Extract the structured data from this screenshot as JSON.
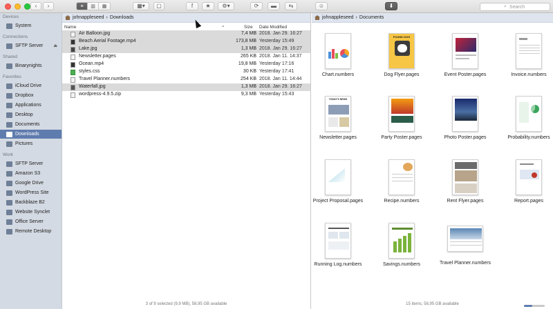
{
  "toolbar": {
    "back": "‹",
    "forward": "›",
    "view_modes": [
      "≡",
      "▥",
      "▦"
    ],
    "arrange": "▦▾",
    "doc": "▢",
    "ftp": "f",
    "star": "★",
    "gear": "⚙▾",
    "sync": "⟳",
    "terminal": "▬",
    "link": "⇆",
    "smile": "☺",
    "download": "⬇",
    "search_placeholder": "Search"
  },
  "sidebar": {
    "sections": [
      {
        "title": "Devices",
        "items": [
          {
            "label": "System",
            "icon": "disk-icon"
          }
        ]
      },
      {
        "title": "Connections",
        "items": [
          {
            "label": "SFTP Server",
            "icon": "server-icon",
            "eject": "⏏"
          }
        ]
      },
      {
        "title": "Shared",
        "items": [
          {
            "label": "Binarynights",
            "icon": "computer-icon"
          }
        ]
      },
      {
        "title": "Favorites",
        "items": [
          {
            "label": "iCloud Drive",
            "icon": "cloud-icon"
          },
          {
            "label": "Dropbox",
            "icon": "dropbox-icon"
          },
          {
            "label": "Applications",
            "icon": "applications-icon"
          },
          {
            "label": "Desktop",
            "icon": "desktop-icon"
          },
          {
            "label": "Documents",
            "icon": "documents-icon"
          },
          {
            "label": "Downloads",
            "icon": "downloads-icon",
            "selected": true
          },
          {
            "label": "Pictures",
            "icon": "pictures-icon"
          }
        ]
      },
      {
        "title": "Work",
        "items": [
          {
            "label": "SFTP Server",
            "icon": "server-icon"
          },
          {
            "label": "Amazon S3",
            "icon": "server-icon"
          },
          {
            "label": "Google Drive",
            "icon": "server-icon"
          },
          {
            "label": "WordPress Site",
            "icon": "server-icon"
          },
          {
            "label": "Backblaze B2",
            "icon": "server-icon"
          },
          {
            "label": "Website Synclet",
            "icon": "server-icon"
          },
          {
            "label": "Office Server",
            "icon": "server-icon"
          },
          {
            "label": "Remote Desktop",
            "icon": "server-icon"
          }
        ]
      }
    ]
  },
  "left_pane": {
    "path": [
      "johnappleseed",
      "Downloads"
    ],
    "path_sep": "›",
    "columns": {
      "name": "Name",
      "size": "Size",
      "date": "Date Modified",
      "sort": "⌃"
    },
    "files": [
      {
        "name": "Air Balloon.jpg",
        "size": "7,4 MB",
        "date": "2018. Jan 29. 16:27",
        "selected": true
      },
      {
        "name": "Beach Aerial Footage.mp4",
        "size": "173,8 MB",
        "date": "Yesterday 15:49",
        "selected": true
      },
      {
        "name": "Lake.jpg",
        "size": "1,3 MB",
        "date": "2018. Jan 29. 16:27",
        "selected": true
      },
      {
        "name": "Newsletter.pages",
        "size": "265 KB",
        "date": "2018. Jan 11. 14:37",
        "selected": false
      },
      {
        "name": "Ocean.mp4",
        "size": "19,8 MB",
        "date": "Yesterday 17:16",
        "selected": false
      },
      {
        "name": "styles.css",
        "size": "30 KB",
        "date": "Yesterday 17:41",
        "selected": false
      },
      {
        "name": "Travel Planner.numbers",
        "size": "254 KB",
        "date": "2018. Jan 11. 14:44",
        "selected": false
      },
      {
        "name": "Waterfall.jpg",
        "size": "1,3 MB",
        "date": "2018. Jan 29. 16:27",
        "selected": true
      },
      {
        "name": "wordpress-4.9.5.zip",
        "size": "9,3 MB",
        "date": "Yesterday 15:43",
        "selected": false
      }
    ],
    "status": "3 of 9 selected (9,9 MB), 58,95 GB available"
  },
  "right_pane": {
    "path": [
      "johnappleseed",
      "Documents"
    ],
    "path_sep": "›",
    "items": [
      {
        "label": "Chart.numbers",
        "icon": "numbers-doc-icon"
      },
      {
        "label": "Dog Flyer.pages",
        "icon": "pages-doc-icon"
      },
      {
        "label": "Event Poster.pages",
        "icon": "pages-doc-icon"
      },
      {
        "label": "Invoice.numbers",
        "icon": "numbers-doc-icon"
      },
      {
        "label": "Newsletter.pages",
        "icon": "pages-doc-icon"
      },
      {
        "label": "Party Poster.pages",
        "icon": "pages-doc-icon"
      },
      {
        "label": "Photo Poster.pages",
        "icon": "pages-doc-icon"
      },
      {
        "label": "Probability.numbers",
        "icon": "numbers-doc-icon"
      },
      {
        "label": "Project Proposal.pages",
        "icon": "pages-doc-icon"
      },
      {
        "label": "Recipe.numbers",
        "icon": "numbers-doc-icon"
      },
      {
        "label": "Rent Flyer.pages",
        "icon": "pages-doc-icon"
      },
      {
        "label": "Report.pages",
        "icon": "pages-doc-icon"
      },
      {
        "label": "Running Log.numbers",
        "icon": "numbers-doc-icon"
      },
      {
        "label": "Savings.numbers",
        "icon": "numbers-doc-icon"
      },
      {
        "label": "Travel Planner.numbers",
        "icon": "numbers-doc-icon"
      }
    ],
    "status": "15 items, 58,95 GB available",
    "thumb_text": {
      "dog": "FOUND DOG",
      "news": "TODAY'S NEWS"
    }
  },
  "colors": {
    "selection": "#5f7cae",
    "sidebar_bg": "#d4dae3",
    "pathbar_bg": "#dfe5ef",
    "row_highlight": "#dadada"
  }
}
